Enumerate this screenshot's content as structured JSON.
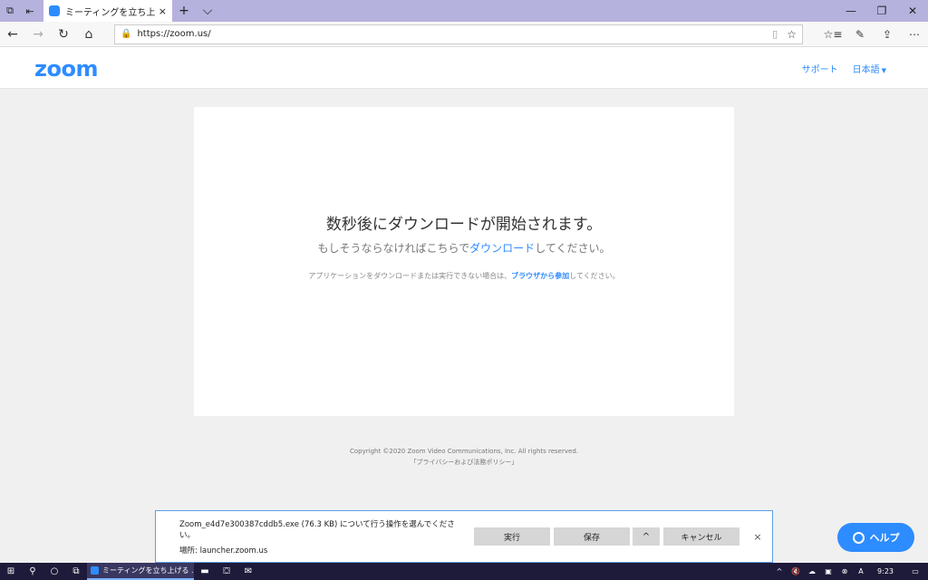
{
  "browser": {
    "tab_title": "ミーティングを立ち上げる - Zoom",
    "tab_close": "×",
    "new_tab": "+",
    "tab_list": "⌵",
    "address_url": "https://zoom.us/",
    "icons": {
      "back": "←",
      "forward": "→",
      "refresh": "↻",
      "home": "⌂",
      "lock": "🔒",
      "reader": "▯",
      "favorite": "☆",
      "favorites_bar": "☆≡",
      "pen": "✎",
      "share": "⇪",
      "more": "⋯",
      "minimize": "—",
      "maximize": "❐",
      "close": "✕",
      "tab_set_aside": "⧉",
      "tab_preview": "⇤"
    }
  },
  "zoom_header": {
    "logo": "zoom",
    "support": "サポート",
    "language": "日本語",
    "language_caret": "▼"
  },
  "card": {
    "headline": "数秒後にダウンロードが開始されます。",
    "sub_before": "もしそうならなければこちらで",
    "sub_link": "ダウンロード",
    "sub_after": "してください。",
    "hint_before": "アプリケーションをダウンロードまたは実行できない場合は、",
    "hint_link": "ブラウザから参加",
    "hint_after": "してください。"
  },
  "footer": {
    "copyright": "Copyright ©2020 Zoom Video Communications, Inc. All rights reserved.",
    "privacy": "「プライバシーおよび法務ポリシー」"
  },
  "download_bar": {
    "message": "Zoom_e4d7e300387cddb5.exe (76.3 KB) について行う操作を選んでください。",
    "source": "場所: launcher.zoom.us",
    "run": "実行",
    "save": "保存",
    "save_options": "^",
    "cancel": "キャンセル",
    "close": "×"
  },
  "help_button": {
    "label": "ヘルプ"
  },
  "taskbar": {
    "start": "⊞",
    "search": "⚲",
    "cortana": "○",
    "task_view": "⧉",
    "app_label": "ミーティングを立ち上げる ...",
    "explorer": "▬",
    "store": "⛋",
    "mail": "✉",
    "tray": {
      "chevron": "^",
      "volume": "🔇",
      "onedrive": "☁",
      "icon1": "▣",
      "icon2": "⊗",
      "icon3": "A",
      "time": "9:23",
      "notifications": "▭"
    }
  },
  "colors": {
    "accent": "#2d8cff",
    "titlebar": "#b6b2de",
    "taskbar": "#1e1b3a"
  }
}
